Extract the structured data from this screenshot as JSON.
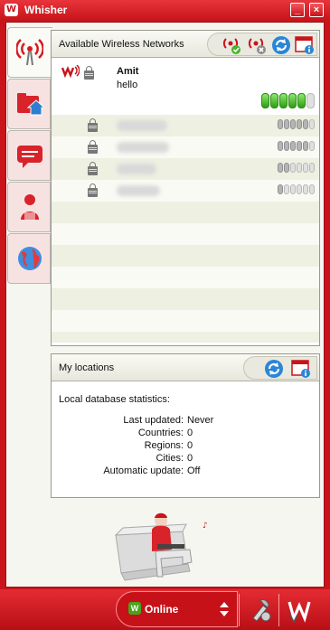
{
  "window": {
    "title": "Whisher",
    "logo": "W",
    "minimize_label": "_",
    "close_label": "×"
  },
  "tabs": [
    {
      "name": "tab-networks",
      "icon": "wireless-signal-icon"
    },
    {
      "name": "tab-locations",
      "icon": "folder-home-icon"
    },
    {
      "name": "tab-chat",
      "icon": "chat-bubble-icon"
    },
    {
      "name": "tab-user",
      "icon": "user-icon"
    },
    {
      "name": "tab-globe",
      "icon": "globe-icon"
    }
  ],
  "networks_panel": {
    "title": "Available Wireless Networks",
    "tools": [
      "connect-icon",
      "disconnect-icon",
      "refresh-icon",
      "info-window-icon"
    ]
  },
  "selected_network": {
    "name": "Amit",
    "description": "hello",
    "signal_level": 5
  },
  "networks": [
    {
      "signal_level": 5
    },
    {
      "signal_level": 5
    },
    {
      "signal_level": 2
    },
    {
      "signal_level": 1
    }
  ],
  "locations_panel": {
    "title": "My locations",
    "tools": [
      "refresh-icon",
      "info-window-icon"
    ],
    "stats_title": "Local database statistics:",
    "stats": [
      {
        "label": "Last updated:",
        "value": "Never"
      },
      {
        "label": "Countries:",
        "value": "0"
      },
      {
        "label": "Regions:",
        "value": "0"
      },
      {
        "label": "Cities:",
        "value": "0"
      },
      {
        "label": "Automatic update:",
        "value": "Off"
      }
    ]
  },
  "bottom": {
    "status": "Online",
    "status_icon": "W"
  },
  "colors": {
    "brand_red": "#c8141b",
    "signal_green": "#2d9c12"
  }
}
